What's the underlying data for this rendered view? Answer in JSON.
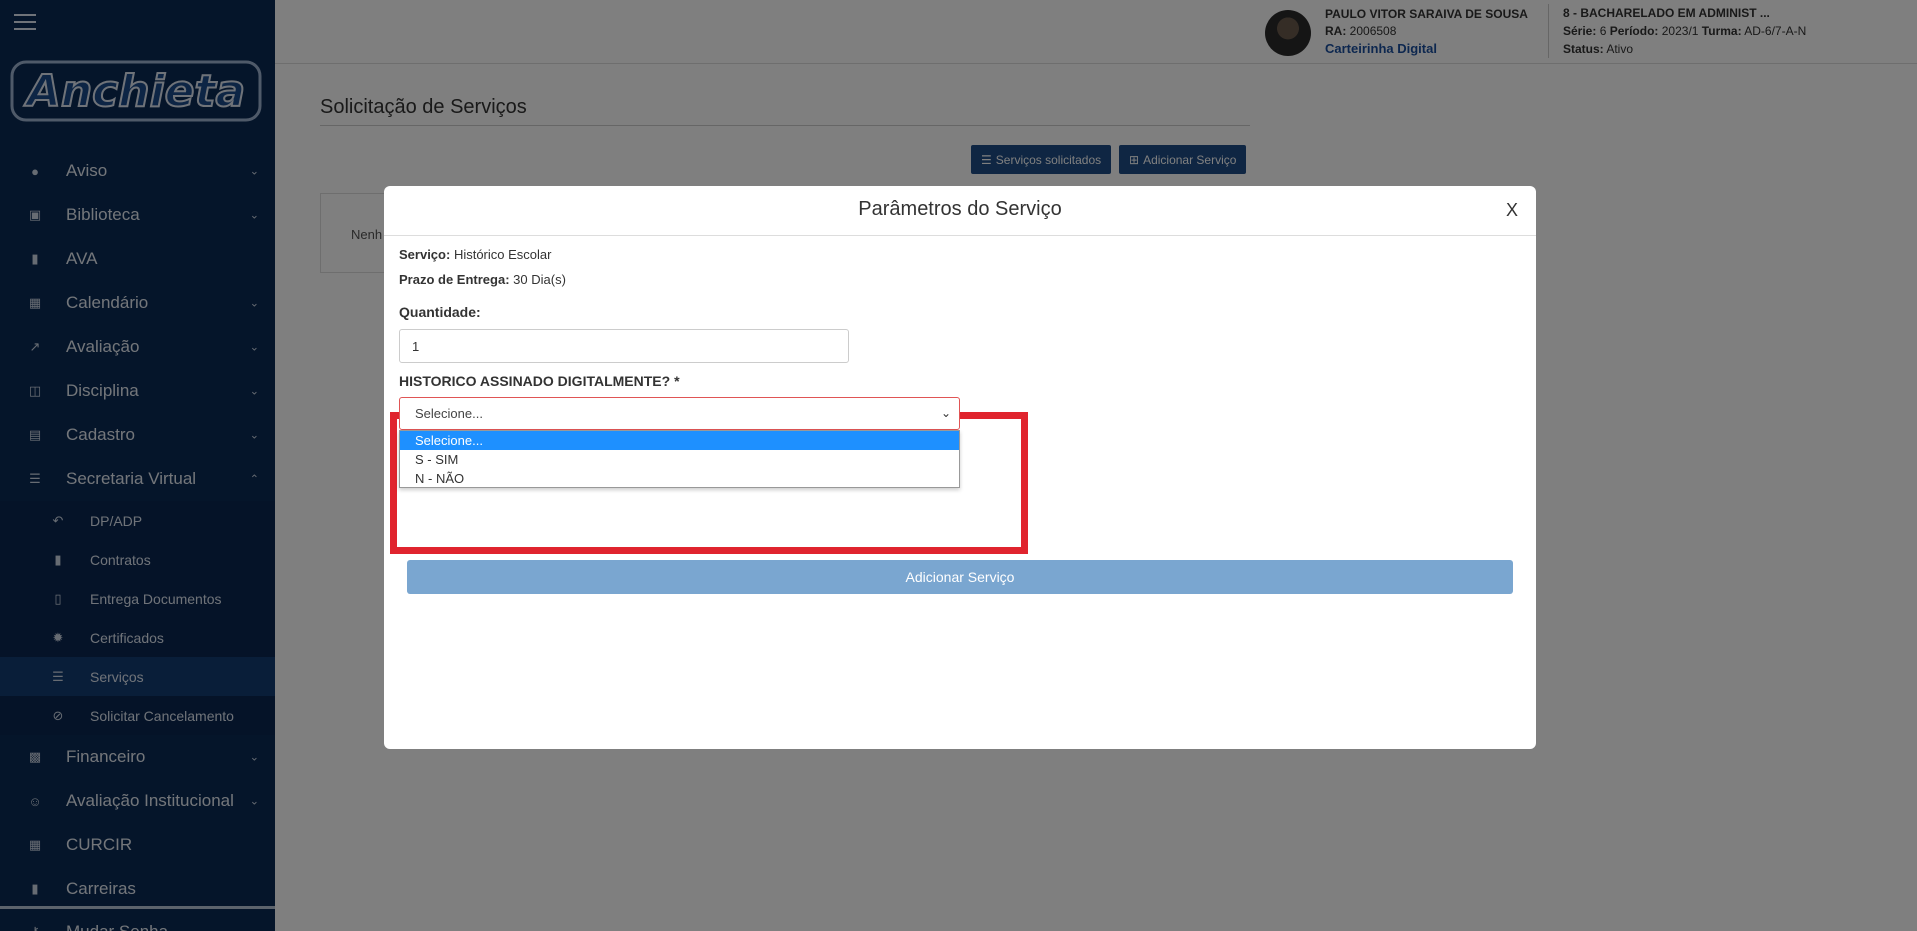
{
  "sidebar": {
    "logo_text": "Anchieta",
    "items": [
      {
        "label": "Aviso",
        "icon": "bell-icon",
        "expandable": true
      },
      {
        "label": "Biblioteca",
        "icon": "bank-icon",
        "expandable": true
      },
      {
        "label": "AVA",
        "icon": "book-icon",
        "expandable": false
      },
      {
        "label": "Calendário",
        "icon": "calendar-icon",
        "expandable": true
      },
      {
        "label": "Avaliação",
        "icon": "chart-line-icon",
        "expandable": true
      },
      {
        "label": "Disciplina",
        "icon": "book-open-icon",
        "expandable": true
      },
      {
        "label": "Cadastro",
        "icon": "id-card-icon",
        "expandable": true
      },
      {
        "label": "Secretaria Virtual",
        "icon": "list-icon",
        "expandable": true,
        "expanded": true
      }
    ],
    "subitems": [
      {
        "label": "DP/ADP",
        "icon": "reply-icon"
      },
      {
        "label": "Contratos",
        "icon": "file-icon"
      },
      {
        "label": "Entrega Documentos",
        "icon": "file-outline-icon"
      },
      {
        "label": "Certificados",
        "icon": "certificate-icon"
      },
      {
        "label": "Serviços",
        "icon": "list-icon",
        "active": true
      },
      {
        "label": "Solicitar Cancelamento",
        "icon": "ban-icon"
      }
    ],
    "items_after": [
      {
        "label": "Financeiro",
        "icon": "money-icon",
        "expandable": true
      },
      {
        "label": "Avaliação Institucional",
        "icon": "smile-icon",
        "expandable": true
      },
      {
        "label": "CURCIR",
        "icon": "grid-icon",
        "expandable": false
      },
      {
        "label": "Carreiras",
        "icon": "book-icon",
        "expandable": false
      }
    ],
    "bottom_item": {
      "label": "Mudar Senha",
      "icon": "key-icon"
    }
  },
  "header": {
    "user_name": "PAULO VITOR SARAIVA DE SOUSA",
    "ra_label": "RA:",
    "ra_value": "2006508",
    "card_link": "Carteirinha Digital",
    "course": "8 - BACHARELADO EM ADMINIST ...",
    "serie_label": "Série:",
    "serie_value": "6",
    "periodo_label": "Período:",
    "periodo_value": "2023/1",
    "turma_label": "Turma:",
    "turma_value": "AD-6/7-A-N",
    "status_label": "Status:",
    "status_value": "Ativo"
  },
  "page": {
    "title": "Solicitação de Serviços",
    "btn_requested": "Serviços solicitados",
    "btn_add": "Adicionar Serviço",
    "card_text": "Nenh"
  },
  "modal": {
    "title": "Parâmetros do Serviço",
    "close": "X",
    "service_label": "Serviço:",
    "service_value": "Histórico Escolar",
    "deadline_label": "Prazo de Entrega:",
    "deadline_value": "30 Dia(s)",
    "qty_label": "Quantidade:",
    "qty_value": "1",
    "signed_label": "HISTORICO ASSINADO DIGITALMENTE? *",
    "select_value": "Selecione...",
    "options": [
      "Selecione...",
      "S - SIM",
      "N - NÃO"
    ],
    "add_button": "Adicionar Serviço"
  },
  "colors": {
    "sidebar_bg": "#0b2a55",
    "primary_button": "#1f4d86",
    "highlight_border": "#e0242e",
    "selected_option": "#1e90ff"
  }
}
